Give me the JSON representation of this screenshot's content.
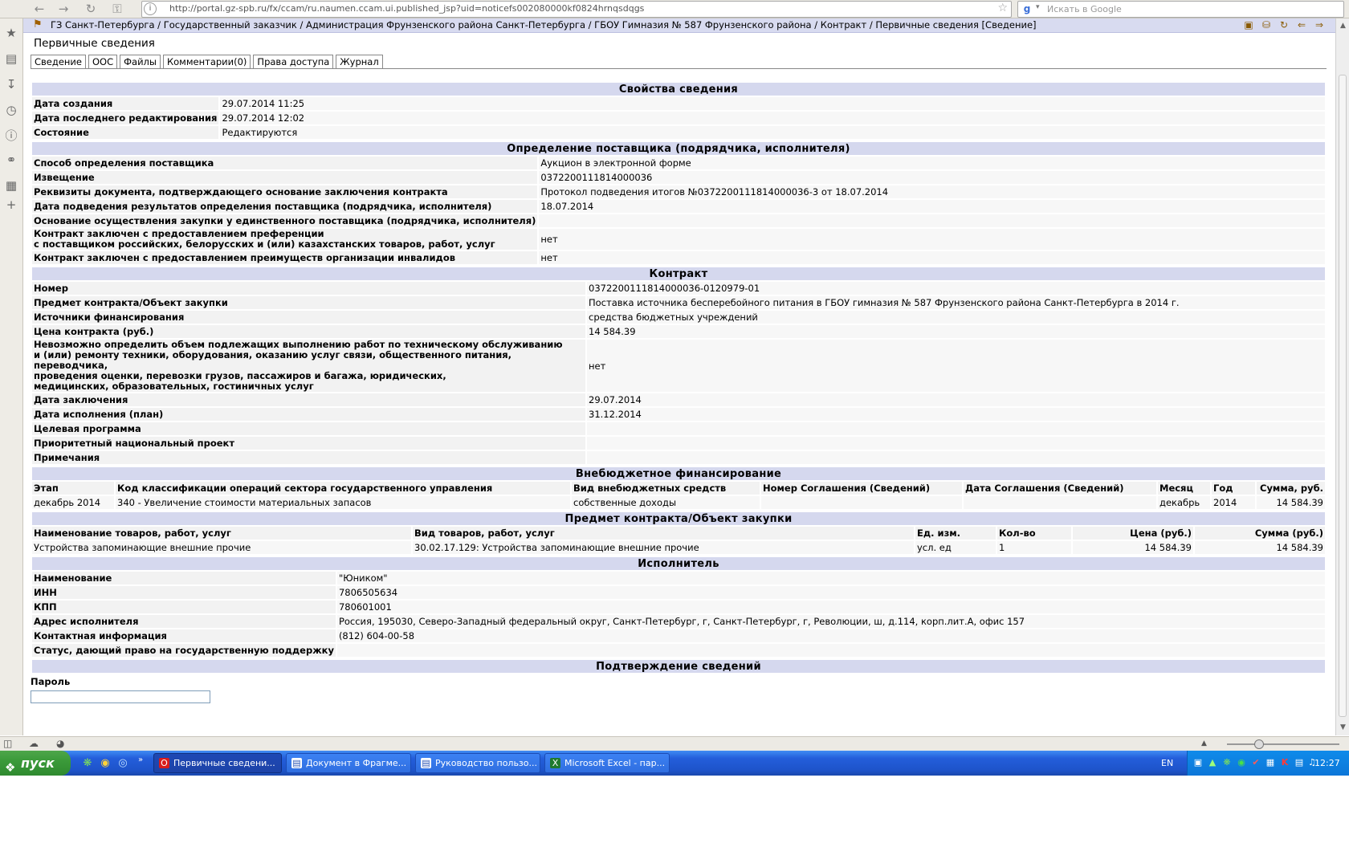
{
  "browser": {
    "url": "http://portal.gz-spb.ru/fx/ccam/ru.naumen.ccam.ui.published_jsp?uid=noticefs002080000kf0824hrnqsdqgs",
    "search_placeholder": "Искать в Google"
  },
  "breadcrumb": "ГЗ Санкт-Петербурга / Государственный заказчик / Администрация Фрунзенского района Санкт-Петербурга / ГБОУ Гимназия № 587 Фрунзенского района / Контракт / Первичные сведения [Сведение]",
  "page_title": "Первичные сведения",
  "tabs": [
    "Сведение",
    "ООС",
    "Файлы",
    "Комментарии(0)",
    "Права доступа",
    "Журнал"
  ],
  "props": {
    "title": "Свойства сведения",
    "rows": [
      {
        "label": "Дата создания",
        "value": "29.07.2014 11:25"
      },
      {
        "label": "Дата последнего редактирования",
        "value": "29.07.2014 12:02"
      },
      {
        "label": "Состояние",
        "value": "Редактируются"
      }
    ]
  },
  "supplier": {
    "title": "Определение поставщика (подрядчика, исполнителя)",
    "rows": [
      {
        "label": "Способ определения поставщика",
        "value": "Аукцион в электронной форме"
      },
      {
        "label": "Извещение",
        "value": "0372200111814000036"
      },
      {
        "label": "Реквизиты документа, подтверждающего основание заключения контракта",
        "value": "Протокол подведения итогов №0372200111814000036-3 от 18.07.2014"
      },
      {
        "label": "Дата подведения результатов определения поставщика (подрядчика, исполнителя)",
        "value": "18.07.2014"
      },
      {
        "label": "Основание осуществления закупки у единственного поставщика (подрядчика, исполнителя)",
        "value": ""
      },
      {
        "label": "Контракт заключен с предоставлением преференции\nс поставщиком российских, белорусских и (или) казахстанских товаров, работ, услуг",
        "value": "нет"
      },
      {
        "label": "Контракт заключен с предоставлением преимуществ организации инвалидов",
        "value": "нет"
      }
    ]
  },
  "contract": {
    "title": "Контракт",
    "rows": [
      {
        "label": "Номер",
        "value": "0372200111814000036-0120979-01"
      },
      {
        "label": "Предмет контракта/Объект закупки",
        "value": "Поставка источника бесперебойного питания в ГБОУ гимназия № 587 Фрунзенского района Санкт-Петербурга в 2014 г."
      },
      {
        "label": "Источники финансирования",
        "value": "средства бюджетных учреждений"
      },
      {
        "label": "Цена контракта (руб.)",
        "value": "14 584.39"
      },
      {
        "label": "Невозможно определить объем подлежащих выполнению работ по техническому обслуживанию\nи (или) ремонту техники, оборудования, оказанию услуг связи, общественного питания, переводчика,\nпроведения оценки, перевозки грузов, пассажиров и багажа, юридических,\nмедицинских, образовательных, гостиничных услуг",
        "value": "нет"
      },
      {
        "label": "Дата заключения",
        "value": "29.07.2014"
      },
      {
        "label": "Дата исполнения (план)",
        "value": "31.12.2014"
      },
      {
        "label": "Целевая программа",
        "value": ""
      },
      {
        "label": "Приоритетный национальный проект",
        "value": ""
      },
      {
        "label": "Примечания",
        "value": ""
      }
    ]
  },
  "extrabudget": {
    "title": "Внебюджетное финансирование",
    "headers": [
      "Этап",
      "Код классификации операций сектора государственного управления",
      "Вид внебюджетных средств",
      "Номер Соглашения (Сведений)",
      "Дата Соглашения (Сведений)",
      "Месяц",
      "Год",
      "Сумма, руб."
    ],
    "rows": [
      [
        "декабрь 2014",
        "340 - Увеличение стоимости материальных запасов",
        "собственные доходы",
        "",
        "",
        "декабрь",
        "2014",
        "14 584.39"
      ]
    ]
  },
  "subject": {
    "title": "Предмет контракта/Объект закупки",
    "headers": [
      "Наименование товаров, работ, услуг",
      "Вид товаров, работ, услуг",
      "Ед. изм.",
      "Кол-во",
      "Цена (руб.)",
      "Сумма (руб.)"
    ],
    "rows": [
      [
        "Устройства запоминающие внешние прочие",
        "30.02.17.129: Устройства запоминающие внешние прочие",
        "усл. ед",
        "1",
        "14 584.39",
        "14 584.39"
      ]
    ]
  },
  "executor": {
    "title": "Исполнитель",
    "rows": [
      {
        "label": "Наименование",
        "value": "\"Юником\""
      },
      {
        "label": "ИНН",
        "value": "7806505634"
      },
      {
        "label": "КПП",
        "value": "780601001"
      },
      {
        "label": "Адрес исполнителя",
        "value": "Россия, 195030, Северо-Западный федеральный округ, Санкт-Петербург, г, Санкт-Петербург, г, Революции, ш, д.114, корп.лит.А, офис 157"
      },
      {
        "label": "Контактная информация",
        "value": "(812) 604-00-58"
      },
      {
        "label": "Статус, дающий право на государственную поддержку",
        "value": ""
      }
    ]
  },
  "confirm": {
    "title": "Подтверждение сведений",
    "password_label": "Пароль",
    "password_value": ""
  },
  "taskbar": {
    "start_label": "пуск",
    "windows": [
      {
        "label": "Первичные сведени...",
        "icon": "opera-icon",
        "active": true
      },
      {
        "label": "Документ в Фрагме...",
        "icon": "document-icon",
        "active": false
      },
      {
        "label": "Руководство пользо...",
        "icon": "document-icon",
        "active": false
      },
      {
        "label": "Microsoft Excel - пар...",
        "icon": "excel-icon",
        "active": false
      }
    ],
    "language": "EN",
    "clock": "12:27"
  },
  "colors": {
    "section_header_bg": "#d5d8ee",
    "label_bg": "#f2f2f2",
    "taskbar_blue": "#245edb",
    "start_green": "#3b9a3a"
  }
}
